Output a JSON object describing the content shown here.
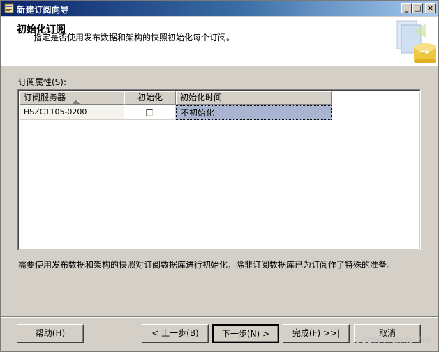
{
  "window": {
    "title": "新建订阅向导",
    "controls": {
      "minimize": "_",
      "maximize": "□",
      "close": "×"
    }
  },
  "header": {
    "title": "初始化订阅",
    "subtitle": "指定是否使用发布数据和架构的快照初始化每个订阅。"
  },
  "grid": {
    "label": "订阅属性(S):",
    "columns": [
      "订阅服务器",
      "初始化",
      "初始化时间"
    ],
    "sort_indicator": "▲",
    "rows": [
      {
        "server": "HSZC1105-0200",
        "initialize_checked": false,
        "time": "不初始化"
      }
    ]
  },
  "note": "需要使用发布数据和架构的快照对订阅数据库进行初始化，除非订阅数据库已为订阅作了特殊的准备。",
  "buttons": {
    "help": "帮助(H)",
    "back": "< 上一步(B)",
    "next": "下一步(N) >",
    "finish": "完成(F) >>|",
    "cancel": "取消"
  },
  "watermark": "CSDN @smile_fire",
  "colors": {
    "titlebar": "#0a246a",
    "dialog_bg": "#d4d0c8",
    "selected_cell": "#a9b5d0"
  }
}
